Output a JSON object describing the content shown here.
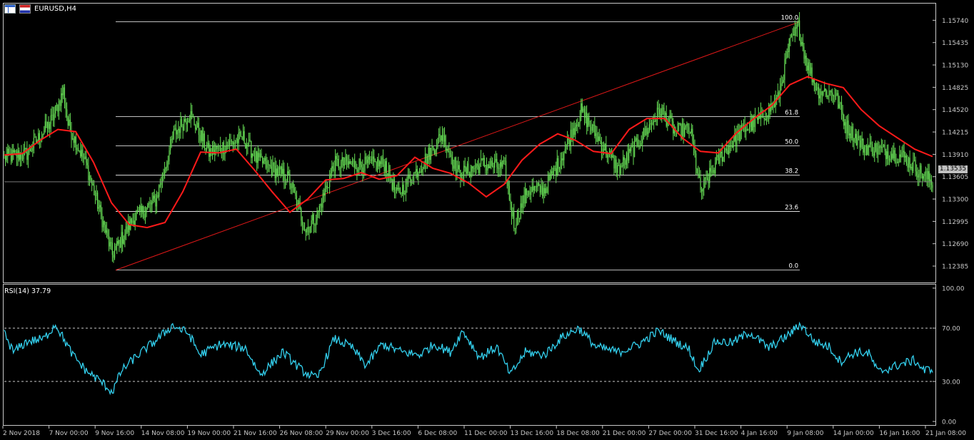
{
  "window": {
    "title": "EURUSD,H4"
  },
  "rsi_panel": {
    "label": "RSI(14) 37.79"
  },
  "current_price_tag": "1.13535",
  "colors": {
    "background": "#000000",
    "candles": "#66dd55",
    "moving_average": "#ff1a1a",
    "fib_trendline": "#e01818",
    "fib_levels": "#ffffff",
    "rsi_line": "#33d0ee",
    "axes": "#c8c8c8"
  },
  "chart_data": [
    {
      "type": "candlestick",
      "title": "EURUSD,H4",
      "ylim": [
        1.1223,
        1.1589
      ],
      "y_ticks": [
        "1.15740",
        "1.15435",
        "1.15130",
        "1.14825",
        "1.14520",
        "1.14215",
        "1.13910",
        "1.13605",
        "1.13300",
        "1.12995",
        "1.12690",
        "1.12385"
      ],
      "x_ticks": [
        "2 Nov 2018",
        "7 Nov 00:00",
        "9 Nov 16:00",
        "14 Nov 08:00",
        "19 Nov 00:00",
        "21 Nov 16:00",
        "26 Nov 08:00",
        "29 Nov 00:00",
        "3 Dec 16:00",
        "6 Dec 08:00",
        "11 Dec 00:00",
        "13 Dec 16:00",
        "18 Dec 08:00",
        "21 Dec 00:00",
        "27 Dec 00:00",
        "31 Dec 16:00",
        "4 Jan 16:00",
        "9 Jan 08:00",
        "14 Jan 00:00",
        "16 Jan 16:00",
        "21 Jan 08:00"
      ],
      "current_price": "1.13535",
      "price_path_keypoints": [
        [
          0,
          1.1387
        ],
        [
          20,
          1.1392
        ],
        [
          42,
          1.1438
        ],
        [
          52,
          1.1478
        ],
        [
          56,
          1.1432
        ],
        [
          72,
          1.1377
        ],
        [
          95,
          1.1254
        ],
        [
          113,
          1.1302
        ],
        [
          133,
          1.1328
        ],
        [
          149,
          1.1418
        ],
        [
          163,
          1.1447
        ],
        [
          180,
          1.1393
        ],
        [
          210,
          1.1414
        ],
        [
          222,
          1.1384
        ],
        [
          250,
          1.1358
        ],
        [
          265,
          1.1288
        ],
        [
          275,
          1.1308
        ],
        [
          290,
          1.1378
        ],
        [
          315,
          1.1377
        ],
        [
          335,
          1.1378
        ],
        [
          345,
          1.1335
        ],
        [
          365,
          1.1373
        ],
        [
          385,
          1.1418
        ],
        [
          400,
          1.1363
        ],
        [
          420,
          1.1378
        ],
        [
          440,
          1.1372
        ],
        [
          448,
          1.1295
        ],
        [
          460,
          1.1342
        ],
        [
          475,
          1.1343
        ],
        [
          490,
          1.1388
        ],
        [
          507,
          1.145
        ],
        [
          525,
          1.1405
        ],
        [
          540,
          1.137
        ],
        [
          560,
          1.1413
        ],
        [
          577,
          1.1452
        ],
        [
          590,
          1.1422
        ],
        [
          603,
          1.1425
        ],
        [
          612,
          1.134
        ],
        [
          630,
          1.1389
        ],
        [
          650,
          1.1425
        ],
        [
          665,
          1.144
        ],
        [
          680,
          1.1466
        ],
        [
          690,
          1.154
        ],
        [
          698,
          1.1565
        ],
        [
          705,
          1.1518
        ],
        [
          715,
          1.1478
        ],
        [
          730,
          1.1475
        ],
        [
          740,
          1.143
        ],
        [
          755,
          1.1402
        ],
        [
          770,
          1.1397
        ],
        [
          790,
          1.1388
        ],
        [
          808,
          1.1363
        ],
        [
          816,
          1.1353
        ]
      ],
      "moving_average": {
        "name": "",
        "values": [
          1.139,
          1.1392,
          1.141,
          1.1425,
          1.1422,
          1.138,
          1.1325,
          1.1295,
          1.1291,
          1.1298,
          1.134,
          1.1394,
          1.1393,
          1.1398,
          1.137,
          1.134,
          1.1312,
          1.133,
          1.1356,
          1.1358,
          1.1366,
          1.1357,
          1.1362,
          1.1387,
          1.1372,
          1.1365,
          1.1352,
          1.1333,
          1.135,
          1.1383,
          1.1405,
          1.1419,
          1.141,
          1.1395,
          1.1392,
          1.1425,
          1.144,
          1.144,
          1.1413,
          1.1395,
          1.1393,
          1.142,
          1.144,
          1.1458,
          1.1486,
          1.1497,
          1.1488,
          1.1482,
          1.1452,
          1.143,
          1.1414,
          1.1398,
          1.1388
        ]
      },
      "fibonacci": {
        "start_price": 1.1233,
        "end_price": 1.1572,
        "levels": [
          {
            "label": "100.0",
            "price": 1.1572
          },
          {
            "label": "61.8",
            "price": 1.14426
          },
          {
            "label": "50.0",
            "price": 1.14025
          },
          {
            "label": "38.2",
            "price": 1.13625
          },
          {
            "label": "23.6",
            "price": 1.1313
          },
          {
            "label": "0.0",
            "price": 1.1233
          }
        ]
      }
    },
    {
      "type": "line",
      "title": "RSI(14) 37.79",
      "ylim": [
        0,
        100
      ],
      "y_ticks": [
        "100.00",
        "70.00",
        "30.00",
        "0.00"
      ],
      "levels": [
        70,
        30
      ],
      "series": [
        {
          "name": "RSI(14)",
          "keypoints": [
            [
              0,
              66
            ],
            [
              8,
              52
            ],
            [
              20,
              60
            ],
            [
              35,
              62
            ],
            [
              45,
              73
            ],
            [
              60,
              50
            ],
            [
              72,
              38
            ],
            [
              85,
              30
            ],
            [
              95,
              22
            ],
            [
              103,
              38
            ],
            [
              115,
              48
            ],
            [
              135,
              62
            ],
            [
              148,
              72
            ],
            [
              162,
              66
            ],
            [
              172,
              50
            ],
            [
              190,
              58
            ],
            [
              212,
              55
            ],
            [
              225,
              35
            ],
            [
              245,
              52
            ],
            [
              262,
              38
            ],
            [
              275,
              32
            ],
            [
              290,
              62
            ],
            [
              305,
              56
            ],
            [
              318,
              42
            ],
            [
              332,
              58
            ],
            [
              350,
              52
            ],
            [
              365,
              50
            ],
            [
              378,
              58
            ],
            [
              392,
              52
            ],
            [
              403,
              68
            ],
            [
              418,
              48
            ],
            [
              433,
              56
            ],
            [
              445,
              35
            ],
            [
              458,
              52
            ],
            [
              475,
              50
            ],
            [
              490,
              63
            ],
            [
              505,
              70
            ],
            [
              520,
              56
            ],
            [
              540,
              52
            ],
            [
              558,
              58
            ],
            [
              575,
              68
            ],
            [
              590,
              60
            ],
            [
              602,
              54
            ],
            [
              610,
              38
            ],
            [
              625,
              60
            ],
            [
              640,
              59
            ],
            [
              655,
              67
            ],
            [
              672,
              55
            ],
            [
              688,
              64
            ],
            [
              700,
              73
            ],
            [
              712,
              60
            ],
            [
              725,
              56
            ],
            [
              735,
              45
            ],
            [
              748,
              52
            ],
            [
              760,
              51
            ],
            [
              768,
              37
            ],
            [
              785,
              42
            ],
            [
              800,
              46
            ],
            [
              809,
              38
            ],
            [
              816,
              40
            ]
          ]
        }
      ]
    }
  ]
}
